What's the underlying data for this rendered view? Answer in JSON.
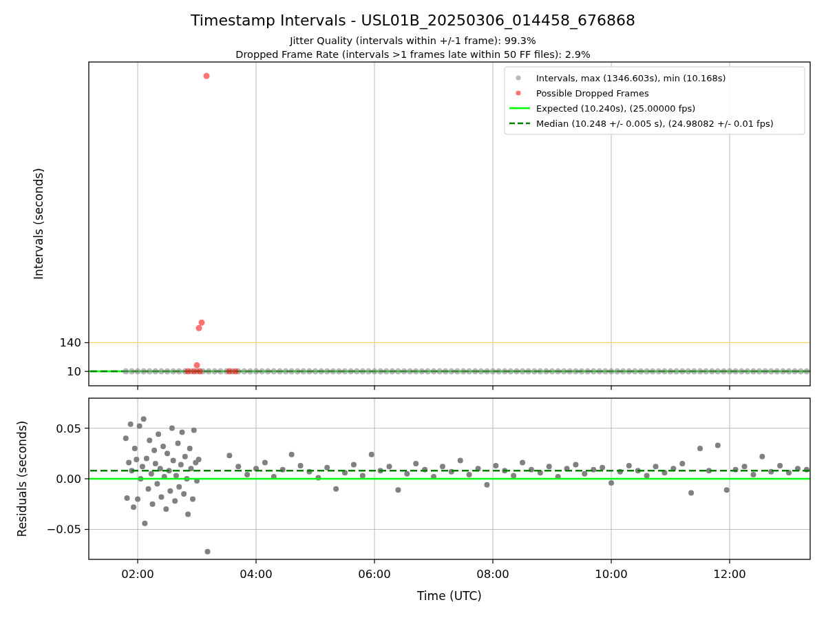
{
  "figure": {
    "title": "Timestamp Intervals - USL01B_20250306_014458_676868",
    "subtitles": [
      "Jitter Quality (intervals within +/-1 frame): 99.3%",
      "Dropped Frame Rate (intervals >1 frames late within 50 FF files): 2.9%"
    ]
  },
  "charts": [
    {
      "chart_data": {
        "type": "scatter",
        "legend": true,
        "ylabel": "Intervals (seconds)",
        "grid": "x",
        "xlim": [
          1.174,
          13.36
        ],
        "ylim": [
          -55,
          1410
        ],
        "yticks": [
          {
            "value": 10,
            "label": "10"
          },
          {
            "value": 140,
            "label": "140"
          }
        ],
        "series": [
          {
            "type": "line",
            "color": "#ffd25e",
            "x": [
              1.174,
              13.36
            ],
            "values": [
              140,
              140
            ]
          },
          {
            "name": "Intervals, max (1346.603s), min (10.168s)",
            "type": "scatter",
            "color": "#808080",
            "x": [
              1.8,
              1.9,
              2.0,
              2.1,
              2.2,
              2.3,
              2.4,
              2.5,
              2.6,
              2.7,
              2.8,
              2.9,
              3.0,
              3.1,
              3.2,
              3.3,
              3.4,
              3.5,
              3.6,
              3.7,
              3.8,
              3.9,
              4.0,
              4.1,
              4.2,
              4.3,
              4.4,
              4.5,
              4.6,
              4.7,
              4.8,
              4.9,
              5.0,
              5.1,
              5.2,
              5.3,
              5.4,
              5.5,
              5.6,
              5.7,
              5.8,
              5.9,
              6.0,
              6.1,
              6.2,
              6.3,
              6.4,
              6.5,
              6.6,
              6.7,
              6.8,
              6.9,
              7.0,
              7.1,
              7.2,
              7.3,
              7.4,
              7.5,
              7.6,
              7.7,
              7.8,
              7.9,
              8.0,
              8.1,
              8.2,
              8.3,
              8.4,
              8.5,
              8.6,
              8.7,
              8.8,
              8.9,
              9.0,
              9.1,
              9.2,
              9.3,
              9.4,
              9.5,
              9.6,
              9.7,
              9.8,
              9.9,
              10.0,
              10.1,
              10.2,
              10.3,
              10.4,
              10.5,
              10.6,
              10.7,
              10.8,
              10.9,
              11.0,
              11.1,
              11.2,
              11.3,
              11.4,
              11.5,
              11.6,
              11.7,
              11.8,
              11.9,
              12.0,
              12.1,
              12.2,
              12.3,
              12.4,
              12.5,
              12.6,
              12.7,
              12.8,
              12.9,
              13.0,
              13.1,
              13.2,
              13.3
            ],
            "values": [
              10.2,
              10.2,
              10.2,
              10.2,
              10.2,
              10.2,
              10.2,
              10.2,
              10.2,
              10.2,
              10.2,
              10.2,
              10.2,
              10.2,
              10.2,
              10.2,
              10.2,
              10.2,
              10.2,
              10.2,
              10.2,
              10.2,
              10.2,
              10.2,
              10.2,
              10.2,
              10.2,
              10.2,
              10.2,
              10.2,
              10.2,
              10.2,
              10.2,
              10.2,
              10.2,
              10.2,
              10.2,
              10.2,
              10.2,
              10.2,
              10.2,
              10.2,
              10.2,
              10.2,
              10.2,
              10.2,
              10.2,
              10.2,
              10.2,
              10.2,
              10.2,
              10.2,
              10.2,
              10.2,
              10.2,
              10.2,
              10.2,
              10.2,
              10.2,
              10.2,
              10.2,
              10.2,
              10.2,
              10.2,
              10.2,
              10.2,
              10.2,
              10.2,
              10.2,
              10.2,
              10.2,
              10.2,
              10.2,
              10.2,
              10.2,
              10.2,
              10.2,
              10.2,
              10.2,
              10.2,
              10.2,
              10.2,
              10.2,
              10.2,
              10.2,
              10.2,
              10.2,
              10.2,
              10.2,
              10.2,
              10.2,
              10.2,
              10.2,
              10.2,
              10.2,
              10.2,
              10.2,
              10.2,
              10.2,
              10.2,
              10.2,
              10.2,
              10.2,
              10.2,
              10.2,
              10.2,
              10.2,
              10.2,
              10.2,
              10.2,
              10.2,
              10.2,
              10.2,
              10.2,
              10.2,
              10.2
            ]
          },
          {
            "name": "Possible Dropped Frames",
            "type": "scatter",
            "color": "#ff0000",
            "x": [
              2.85,
              2.95,
              3.05,
              3.0,
              3.035,
              3.081,
              3.163,
              3.55,
              3.65
            ],
            "values": [
              10.5,
              10.5,
              10.5,
              38,
              206,
              231,
              1346.6,
              10.5,
              10.5
            ]
          },
          {
            "name": "Expected (10.240s), (25.00000 fps)",
            "type": "line",
            "color": "#00ff00",
            "x": [
              1.174,
              13.36
            ],
            "values": [
              10.24,
              10.24
            ]
          },
          {
            "name": "Median (10.248 +/- 0.005 s), (24.98082 +/- 0.01 fps)",
            "type": "line",
            "line_style": "dashed",
            "color": "#008000",
            "x": [
              1.174,
              13.36
            ],
            "values": [
              10.248,
              10.248
            ]
          }
        ]
      }
    },
    {
      "chart_data": {
        "type": "scatter",
        "xlabel": "Time (UTC)",
        "ylabel": "Residuals (seconds)",
        "grid": "both",
        "xlim": [
          1.174,
          13.36
        ],
        "ylim": [
          -0.0796,
          0.0796
        ],
        "xticks": [
          {
            "value": 2,
            "label": "02:00"
          },
          {
            "value": 4,
            "label": "04:00"
          },
          {
            "value": 6,
            "label": "06:00"
          },
          {
            "value": 8,
            "label": "08:00"
          },
          {
            "value": 10,
            "label": "10:00"
          },
          {
            "value": 12,
            "label": "12:00"
          }
        ],
        "yticks": [
          {
            "value": 0.05,
            "label": "0.05"
          },
          {
            "value": 0,
            "label": "0.00"
          },
          {
            "value": -0.05,
            "label": "−0.05"
          }
        ],
        "series": [
          {
            "type": "line",
            "color": "#00ff00",
            "x": [
              1.174,
              13.36
            ],
            "values": [
              0,
              0
            ]
          },
          {
            "type": "line",
            "line_style": "dashed",
            "color": "#008000",
            "x": [
              1.174,
              13.36
            ],
            "values": [
              0.008,
              0.008
            ]
          },
          {
            "type": "scatter",
            "color": "#808080",
            "x": [
              1.8,
              1.82,
              1.85,
              1.88,
              1.9,
              1.93,
              1.95,
              1.98,
              2.0,
              2.03,
              2.05,
              2.08,
              2.1,
              2.12,
              2.15,
              2.18,
              2.2,
              2.23,
              2.25,
              2.28,
              2.3,
              2.33,
              2.35,
              2.38,
              2.4,
              2.43,
              2.45,
              2.48,
              2.5,
              2.53,
              2.55,
              2.58,
              2.6,
              2.63,
              2.65,
              2.68,
              2.7,
              2.73,
              2.75,
              2.78,
              2.8,
              2.83,
              2.85,
              2.88,
              2.9,
              2.93,
              2.95,
              2.98,
              3.0,
              3.03,
              3.18,
              3.55,
              3.7,
              3.85,
              4.0,
              4.15,
              4.3,
              4.45,
              4.6,
              4.75,
              4.9,
              5.05,
              5.2,
              5.35,
              5.5,
              5.65,
              5.8,
              5.95,
              6.1,
              6.25,
              6.4,
              6.55,
              6.7,
              6.85,
              7.0,
              7.15,
              7.3,
              7.45,
              7.6,
              7.75,
              7.9,
              8.05,
              8.2,
              8.35,
              8.5,
              8.65,
              8.8,
              8.95,
              9.1,
              9.25,
              9.4,
              9.55,
              9.7,
              9.85,
              10.0,
              10.15,
              10.3,
              10.45,
              10.6,
              10.75,
              10.9,
              11.05,
              11.2,
              11.35,
              11.5,
              11.65,
              11.8,
              11.95,
              12.1,
              12.25,
              12.4,
              12.55,
              12.7,
              12.85,
              13.0,
              13.15,
              13.3
            ],
            "values": [
              0.04,
              -0.019,
              0.016,
              0.054,
              0.008,
              -0.028,
              0.03,
              0.019,
              -0.02,
              0.052,
              0.0,
              0.012,
              0.059,
              -0.044,
              0.02,
              -0.01,
              0.038,
              0.005,
              -0.025,
              0.028,
              0.015,
              -0.005,
              0.044,
              0.01,
              -0.018,
              0.032,
              0.002,
              -0.03,
              0.025,
              0.008,
              -0.012,
              0.05,
              0.018,
              -0.022,
              0.003,
              0.035,
              -0.008,
              0.014,
              0.046,
              -0.015,
              0.022,
              0.0,
              -0.035,
              0.03,
              0.01,
              -0.02,
              0.048,
              0.016,
              -0.002,
              0.019,
              -0.072,
              0.023,
              0.012,
              0.004,
              0.01,
              0.016,
              0.002,
              0.009,
              0.024,
              0.013,
              0.007,
              0.001,
              0.011,
              -0.01,
              0.006,
              0.014,
              0.003,
              0.024,
              0.008,
              0.012,
              -0.011,
              0.005,
              0.015,
              0.009,
              0.002,
              0.012,
              0.007,
              0.018,
              0.004,
              0.01,
              -0.006,
              0.013,
              0.008,
              0.003,
              0.016,
              0.009,
              0.006,
              0.012,
              0.002,
              0.01,
              0.014,
              0.005,
              0.009,
              0.011,
              -0.004,
              0.007,
              0.013,
              0.008,
              0.003,
              0.012,
              0.006,
              0.01,
              0.015,
              -0.014,
              0.03,
              0.008,
              0.033,
              -0.011,
              0.009,
              0.012,
              0.004,
              0.022,
              0.007,
              0.013,
              0.006,
              0.01,
              0.009
            ]
          }
        ]
      }
    }
  ]
}
